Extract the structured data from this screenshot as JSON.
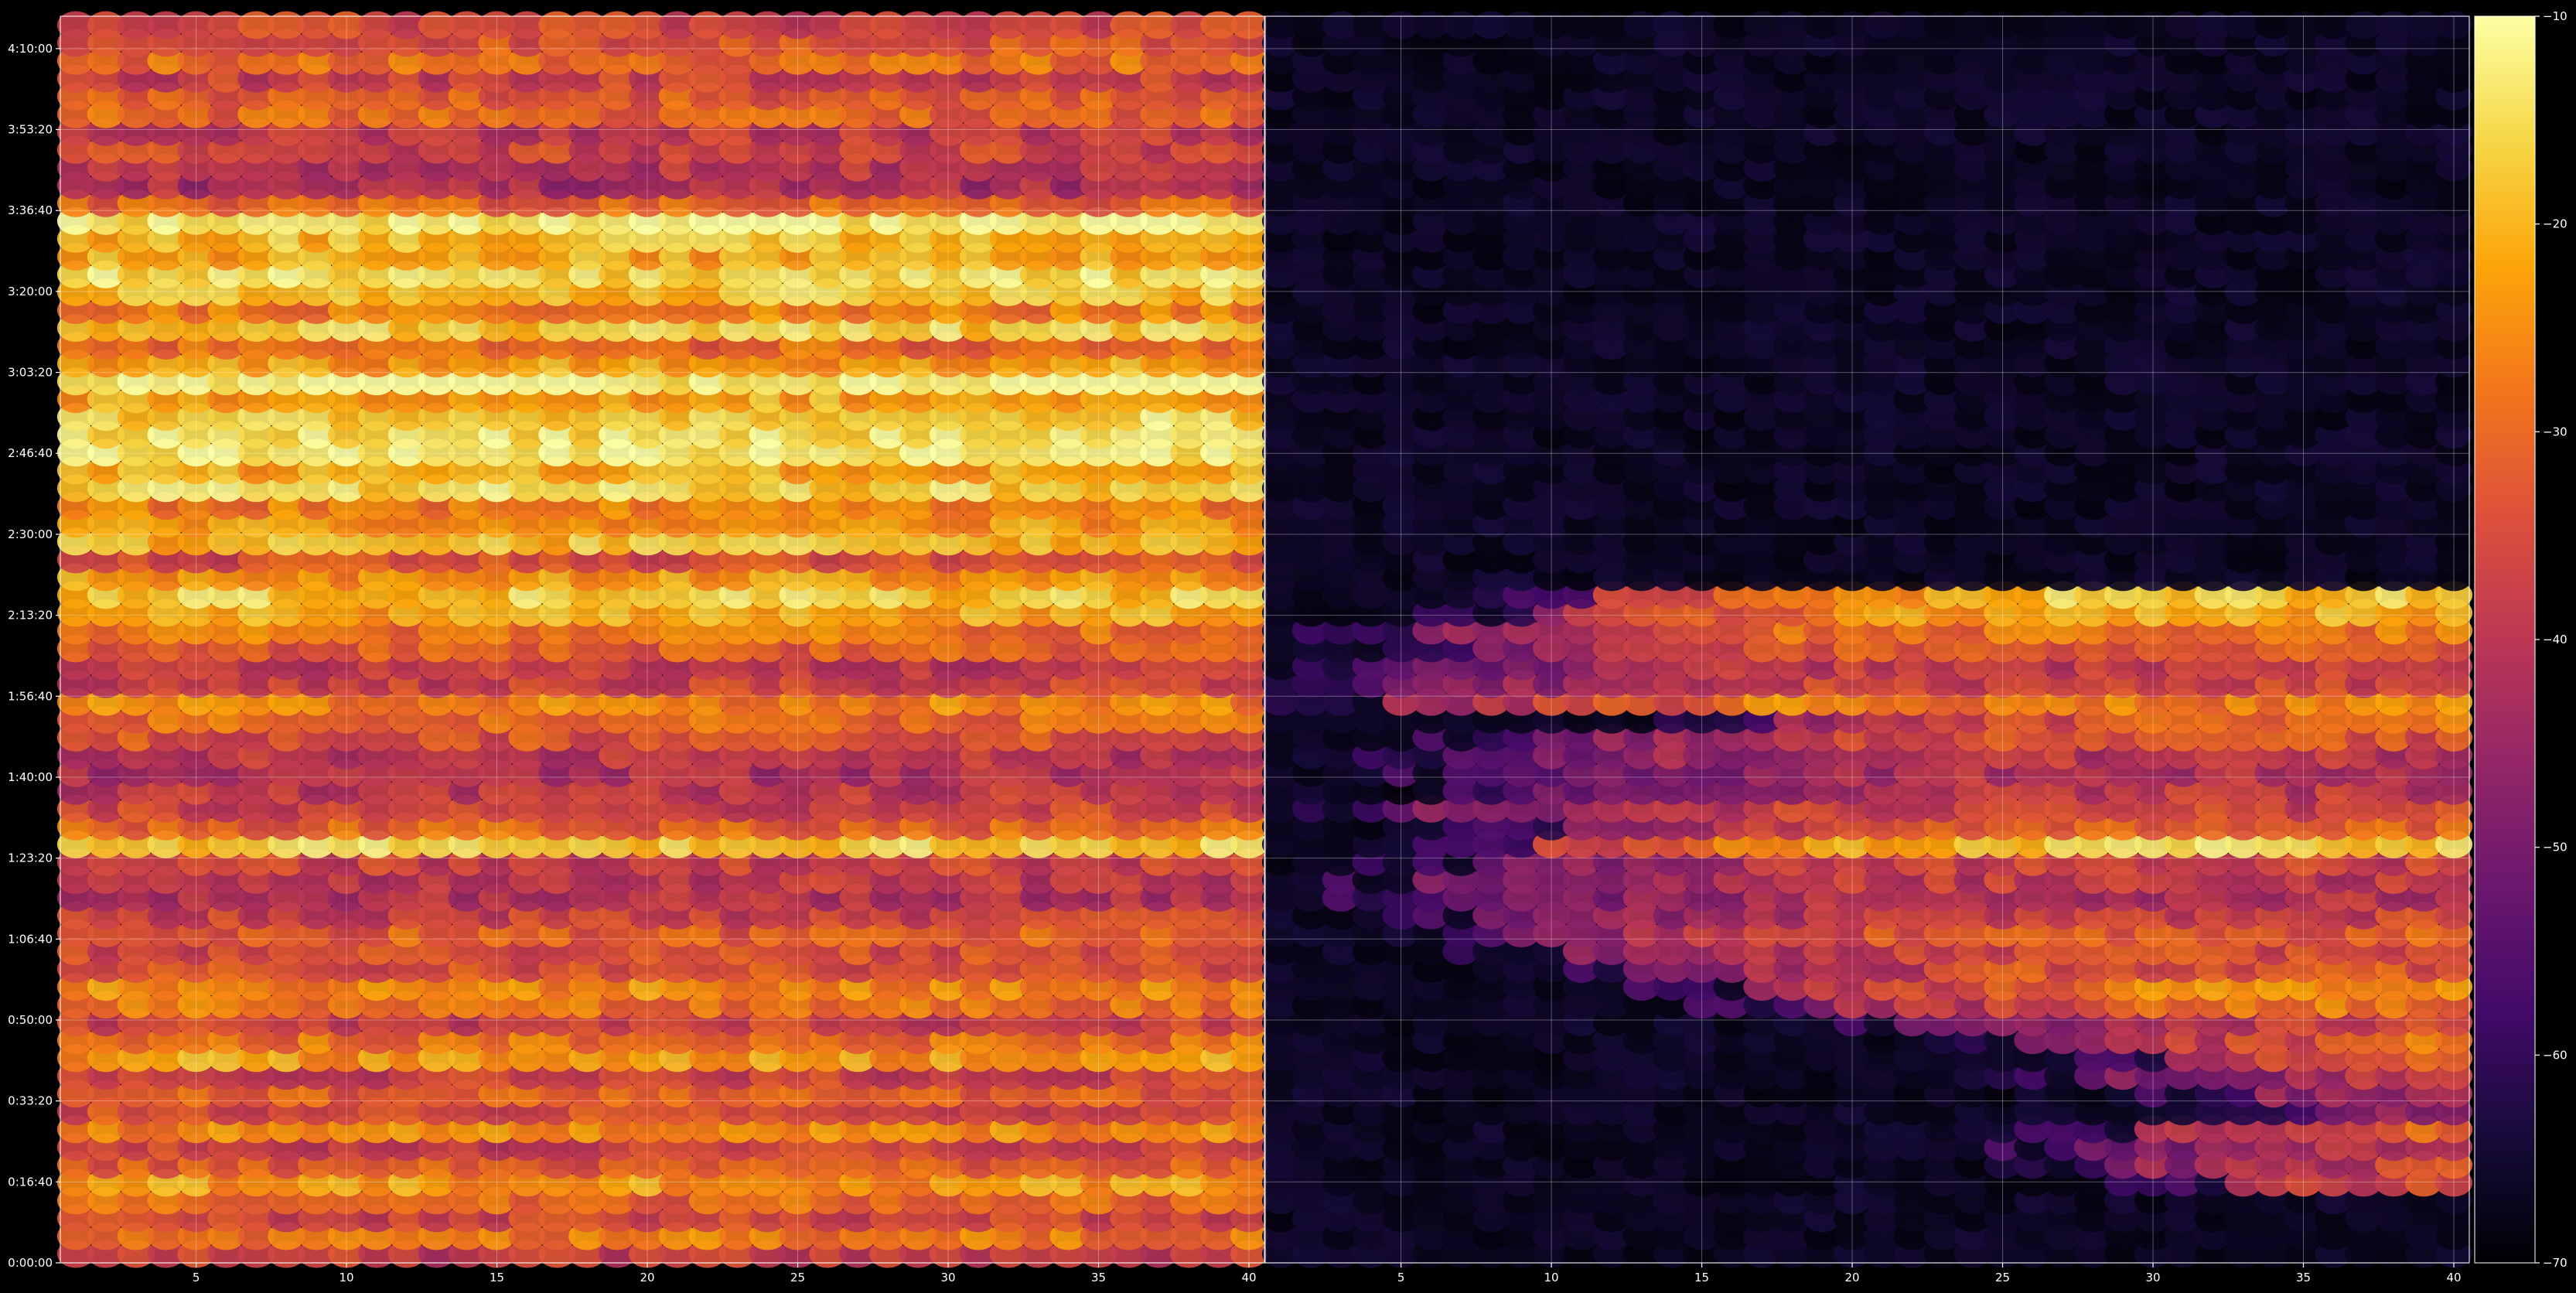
{
  "chart_data": {
    "type": "heatmap",
    "title": "",
    "xlabel": "",
    "ylabel": "",
    "colormap": "inferno",
    "mark_shape": "ellipse",
    "panels": [
      {
        "name": "",
        "xlim": [
          1,
          40
        ],
        "xticks": [
          5,
          10,
          15,
          20,
          25,
          30,
          35,
          40
        ],
        "xtick_labels": [
          "5",
          "10",
          "15",
          "20",
          "25",
          "30",
          "35",
          "40"
        ],
        "onset_x": [
          1
        ]
      },
      {
        "name": "",
        "xlim": [
          1,
          40
        ],
        "xticks": [
          5,
          10,
          15,
          20,
          25,
          30,
          35,
          40
        ],
        "xtick_labels": [
          "5",
          "10",
          "15",
          "20",
          "25",
          "30",
          "35",
          "40"
        ],
        "onset_x": [
          41,
          41,
          41,
          41,
          33,
          29,
          28,
          30,
          36,
          34,
          28,
          31,
          26,
          22,
          19,
          17,
          13,
          11,
          9,
          8,
          6,
          6,
          8,
          10,
          11,
          5,
          10,
          9,
          7,
          10,
          18,
          5,
          5,
          5,
          8,
          6,
          10,
          12,
          41,
          41,
          41,
          41,
          41,
          41,
          41,
          41,
          41,
          41,
          41,
          41,
          41,
          41,
          41,
          41,
          41,
          41,
          41,
          41,
          41,
          41,
          41,
          41,
          41,
          41,
          41,
          41,
          41,
          41,
          41,
          41
        ]
      }
    ],
    "y_seconds_range": [
      0,
      15400
    ],
    "ylim_seconds": [
      0,
      15400
    ],
    "yticks_seconds": [
      0,
      1000,
      2000,
      3000,
      4000,
      5000,
      6000,
      7000,
      8000,
      9000,
      10000,
      11000,
      12000,
      13000,
      14000,
      15000
    ],
    "ytick_labels": [
      "0:00:00",
      "0:16:40",
      "0:33:20",
      "0:50:00",
      "1:06:40",
      "1:23:20",
      "1:40:00",
      "1:56:40",
      "2:13:20",
      "2:30:00",
      "2:46:40",
      "3:03:20",
      "3:20:00",
      "3:36:40",
      "3:53:20",
      "4:10:00"
    ],
    "colorbar": {
      "range": [
        -70,
        -10
      ],
      "ticks": [
        -70,
        -60,
        -50,
        -40,
        -30,
        -20,
        -10
      ],
      "tick_labels": [
        "−70",
        "−60",
        "−50",
        "−40",
        "−30",
        "−20",
        "−10"
      ]
    },
    "grid": true,
    "strength_by_row": [
      0.38,
      0.62,
      0.42,
      0.55,
      0.7,
      0.5,
      0.4,
      0.66,
      0.45,
      0.52,
      0.4,
      0.72,
      0.58,
      0.4,
      0.6,
      0.68,
      0.48,
      0.45,
      0.52,
      0.4,
      0.32,
      0.36,
      0.4,
      0.86,
      0.55,
      0.42,
      0.35,
      0.3,
      0.34,
      0.48,
      0.58,
      0.64,
      0.4,
      0.36,
      0.52,
      0.6,
      0.74,
      0.84,
      0.7,
      0.45,
      0.8,
      0.7,
      0.62,
      0.88,
      0.75,
      0.96,
      0.92,
      0.88,
      0.75,
      0.98,
      0.72,
      0.55,
      0.85,
      0.62,
      0.82,
      0.9,
      0.74,
      0.8,
      0.96,
      0.54,
      0.28,
      0.34,
      0.42,
      0.36,
      0.55,
      0.5,
      0.4,
      0.58,
      0.48,
      0.42
    ],
    "strength_min": 0.25,
    "strength_max": 1
  }
}
